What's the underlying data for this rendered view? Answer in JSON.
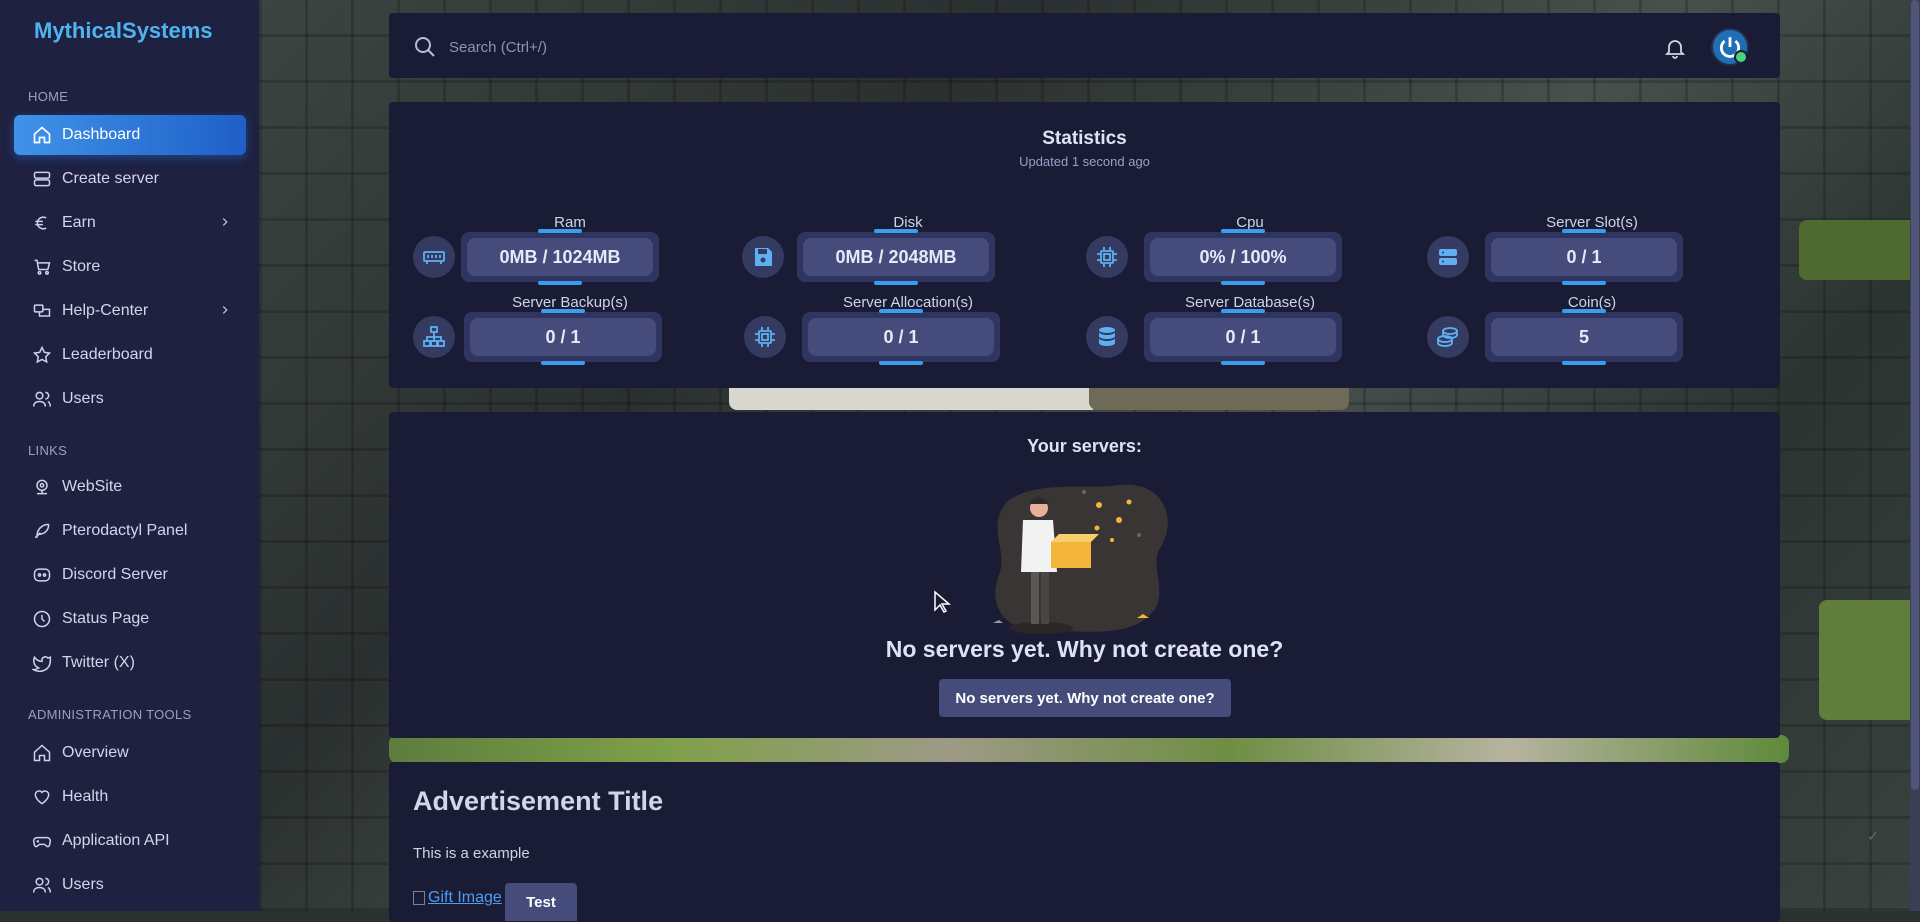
{
  "brand": "MythicalSystems",
  "colors": {
    "accent": "#3f93e8",
    "sidebar_bg": "#1f2140",
    "panel_bg": "#1a1c35",
    "brand": "#4fb3f0",
    "online": "#4cd37b"
  },
  "sidebar": {
    "sections": [
      {
        "title": "HOME",
        "items": [
          {
            "label": "Dashboard",
            "icon": "home-icon",
            "active": true
          },
          {
            "label": "Create server",
            "icon": "server-icon"
          },
          {
            "label": "Earn",
            "icon": "euro-icon",
            "submenu": true
          },
          {
            "label": "Store",
            "icon": "cart-icon"
          },
          {
            "label": "Help-Center",
            "icon": "help-icon",
            "submenu": true
          },
          {
            "label": "Leaderboard",
            "icon": "star-icon"
          },
          {
            "label": "Users",
            "icon": "users-icon"
          }
        ]
      },
      {
        "title": "LINKS",
        "items": [
          {
            "label": "WebSite",
            "icon": "globe-icon"
          },
          {
            "label": "Pterodactyl Panel",
            "icon": "feather-icon"
          },
          {
            "label": "Discord Server",
            "icon": "discord-icon"
          },
          {
            "label": "Status Page",
            "icon": "clock-icon"
          },
          {
            "label": "Twitter (X)",
            "icon": "twitter-icon"
          }
        ]
      },
      {
        "title": "ADMINISTRATION TOOLS",
        "items": [
          {
            "label": "Overview",
            "icon": "home-icon"
          },
          {
            "label": "Health",
            "icon": "heart-icon"
          },
          {
            "label": "Application API",
            "icon": "gamepad-icon"
          },
          {
            "label": "Users",
            "icon": "users-icon"
          }
        ]
      }
    ]
  },
  "topbar": {
    "search_placeholder": "Search (Ctrl+/)"
  },
  "statistics": {
    "title": "Statistics",
    "updated": "Updated 1 second ago",
    "items": [
      {
        "label": "Ram",
        "value": "0MB / 1024MB",
        "icon": "memory-icon"
      },
      {
        "label": "Disk",
        "value": "0MB / 2048MB",
        "icon": "floppy-disk-icon"
      },
      {
        "label": "Cpu",
        "value": "0% / 100%",
        "icon": "cpu-icon"
      },
      {
        "label": "Server Slot(s)",
        "value": "0 / 1",
        "icon": "server-stack-icon"
      },
      {
        "label": "Server Backup(s)",
        "value": "0 / 1",
        "icon": "network-icon"
      },
      {
        "label": "Server Allocation(s)",
        "value": "0 / 1",
        "icon": "cpu-icon"
      },
      {
        "label": "Server Database(s)",
        "value": "0 / 1",
        "icon": "database-icon"
      },
      {
        "label": "Coin(s)",
        "value": "5",
        "icon": "coins-icon"
      }
    ]
  },
  "servers": {
    "title": "Your servers:",
    "empty_text": "No servers yet. Why not create one?",
    "create_button": "No servers yet. Why not create one?"
  },
  "advertisement": {
    "title": "Advertisement Title",
    "text": "This is a example",
    "image_alt": "Gift Image",
    "button": "Test"
  }
}
